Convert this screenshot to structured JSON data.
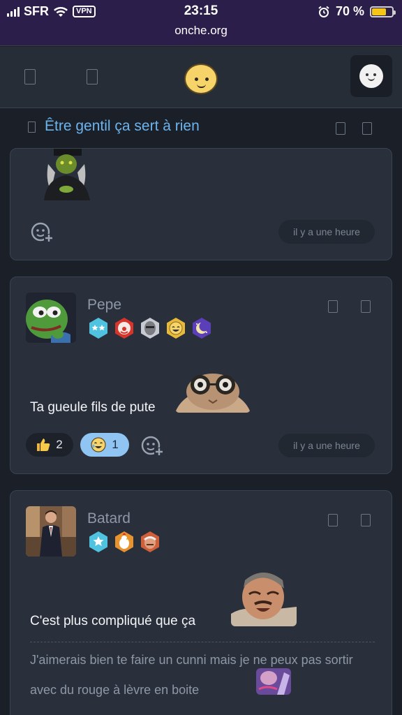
{
  "status_bar": {
    "carrier": "SFR",
    "vpn": "VPN",
    "time": "23:15",
    "battery": "70 %",
    "battery_level": 0.7,
    "url": "onche.org"
  },
  "topic": {
    "title": "Être gentil ça sert à rien"
  },
  "posts": [
    {
      "time": "il y a une heure"
    },
    {
      "username": "Pepe",
      "text": "Ta gueule fils de pute",
      "reactions": [
        {
          "icon": "thumbs-up-icon",
          "count": "2"
        },
        {
          "icon": "laughing-emoji-icon",
          "count": "1"
        }
      ],
      "time": "il y a une heure"
    },
    {
      "username": "Batard",
      "text": "C'est plus compliqué que ça",
      "quote": "J'aimerais bien te faire un cunni mais je ne peux pas sortir avec du rouge à lèvre en boite"
    }
  ],
  "colors": {
    "accent": "#6cb4ee",
    "background": "#1b2028",
    "card": "#29303b",
    "statusbar": "#2b1e4a"
  }
}
